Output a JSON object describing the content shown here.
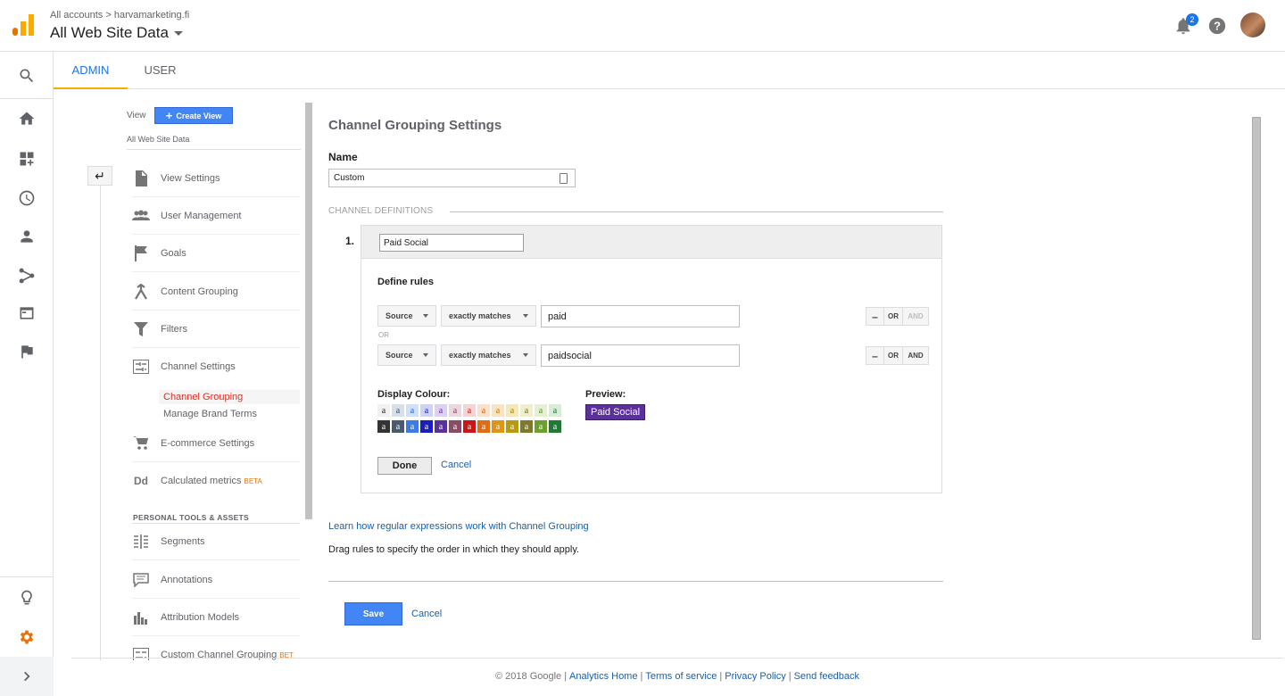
{
  "header": {
    "breadcrumb_all": "All accounts",
    "breadcrumb_account": "harvamarketing.fi",
    "property_view": "All Web Site Data",
    "notification_count": "2"
  },
  "left_nav": {
    "icons": [
      "search-icon",
      "home-icon",
      "customize-icon",
      "realtime-clock-icon",
      "audience-person-icon",
      "acquisition-icon",
      "behavior-icon",
      "conversions-flag-icon",
      "discover-bulb-icon",
      "admin-gear-icon",
      "expand-chevron-icon"
    ]
  },
  "tabs": [
    {
      "label": "ADMIN"
    },
    {
      "label": "USER"
    }
  ],
  "admin_nav": {
    "view_label": "View",
    "create_view": "Create View",
    "view_name": "All Web Site Data",
    "items": [
      {
        "label": "View Settings"
      },
      {
        "label": "User Management"
      },
      {
        "label": "Goals"
      },
      {
        "label": "Content Grouping"
      },
      {
        "label": "Filters"
      },
      {
        "label": "Channel Settings"
      },
      {
        "label": "E-commerce Settings"
      },
      {
        "label": "Calculated metrics",
        "badge": "BETA"
      }
    ],
    "sub_items": [
      {
        "label": "Channel Grouping"
      },
      {
        "label": "Manage Brand Terms"
      }
    ],
    "personal_header": "PERSONAL TOOLS & ASSETS",
    "personal_items": [
      {
        "label": "Segments"
      },
      {
        "label": "Annotations"
      },
      {
        "label": "Attribution Models"
      },
      {
        "label": "Custom Channel Grouping",
        "badge": "BET"
      }
    ]
  },
  "main": {
    "title": "Channel Grouping Settings",
    "name_label": "Name",
    "name_value": "Custom",
    "channel_definitions": "CHANNEL DEFINITIONS",
    "channel": {
      "number": "1.",
      "name": "Paid Social",
      "define_rules": "Define rules",
      "or_label": "OR",
      "rules": [
        {
          "dimension": "Source",
          "operator": "exactly matches",
          "value": "paid",
          "minus": "–",
          "or": "OR",
          "and": "AND"
        },
        {
          "dimension": "Source",
          "operator": "exactly matches",
          "value": "paidsocial",
          "minus": "–",
          "or": "OR",
          "and": "AND"
        }
      ],
      "display_colour_label": "Display Colour:",
      "preview_label": "Preview:",
      "preview_text": "Paid Social",
      "swatch_letter": "a",
      "light_swatches": [
        {
          "bg": "#f1f1f1",
          "fg": "#222222"
        },
        {
          "bg": "#d7dfe8",
          "fg": "#3b4a5c"
        },
        {
          "bg": "#cfe0fa",
          "fg": "#2563c9"
        },
        {
          "bg": "#cfd2f4",
          "fg": "#1a1aa6"
        },
        {
          "bg": "#ddd0f0",
          "fg": "#5b2f9c"
        },
        {
          "bg": "#ecd7df",
          "fg": "#7a3d55"
        },
        {
          "bg": "#f7d4d4",
          "fg": "#c41212"
        },
        {
          "bg": "#fbe1cc",
          "fg": "#d2600b"
        },
        {
          "bg": "#f9e3c4",
          "fg": "#c5780a"
        },
        {
          "bg": "#f5e8b8",
          "fg": "#9e7d00"
        },
        {
          "bg": "#efeecf",
          "fg": "#6b6b1f"
        },
        {
          "bg": "#e4f0d4",
          "fg": "#5a8c1f"
        },
        {
          "bg": "#d8ecd8",
          "fg": "#1c6b2e"
        }
      ],
      "dark_swatches": [
        {
          "bg": "#333333",
          "fg": "#ffffff"
        },
        {
          "bg": "#4a5b70",
          "fg": "#ffffff"
        },
        {
          "bg": "#3b7be5",
          "fg": "#ffffff"
        },
        {
          "bg": "#1c1cbf",
          "fg": "#ffffff"
        },
        {
          "bg": "#5b2f9c",
          "fg": "#ffffff"
        },
        {
          "bg": "#8a4b64",
          "fg": "#ffffff"
        },
        {
          "bg": "#cc1515",
          "fg": "#ffffff"
        },
        {
          "bg": "#e26c12",
          "fg": "#ffffff"
        },
        {
          "bg": "#e19313",
          "fg": "#ffffff"
        },
        {
          "bg": "#b89a10",
          "fg": "#ffffff"
        },
        {
          "bg": "#7d7a2b",
          "fg": "#ffffff"
        },
        {
          "bg": "#6aa12a",
          "fg": "#ffffff"
        },
        {
          "bg": "#1e7a34",
          "fg": "#ffffff"
        }
      ],
      "done": "Done",
      "cancel": "Cancel"
    },
    "learn_link": "Learn how regular expressions work with Channel Grouping",
    "drag_hint": "Drag rules to specify the order in which they should apply.",
    "save": "Save",
    "cancel": "Cancel"
  },
  "footer": {
    "copyright": "© 2018 Google",
    "links": [
      "Analytics Home",
      "Terms of service",
      "Privacy Policy",
      "Send feedback"
    ]
  },
  "colors": {
    "accent_blue": "#4285f4",
    "tab_underline": "#f9ab00",
    "active_sub": "#d93025",
    "gear_orange": "#e8710a"
  }
}
